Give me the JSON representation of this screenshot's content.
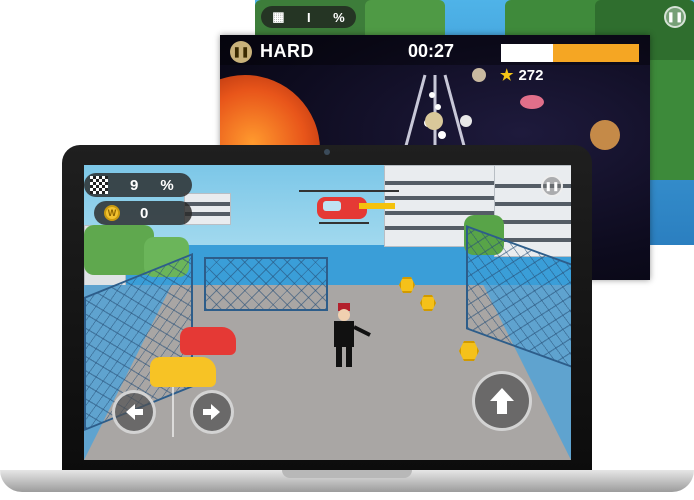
{
  "back_screenshot": {
    "hud": {
      "flag_icon": "checkered-flag-icon",
      "count_a": "I",
      "count_b": "%"
    },
    "pause_icon": "pause-icon"
  },
  "mid_screenshot": {
    "level": "HARD",
    "timer": "00:27",
    "progress_fraction": 0.62,
    "score": "272",
    "pause_icon": "pause-icon",
    "star_icon": "star-icon"
  },
  "main_screenshot": {
    "hud": {
      "flag_icon": "checkered-flag-icon",
      "count_a": "9",
      "count_b": "%",
      "coin_icon": "coin-icon",
      "count_c": "0"
    },
    "pause_icon": "pause-icon",
    "controls": {
      "left": "left-arrow-icon",
      "right": "right-arrow-icon",
      "jump": "up-arrow-icon"
    }
  },
  "colors": {
    "accent": "#f5a623",
    "coin": "#f5c11a",
    "helicopter": "#e53935"
  }
}
